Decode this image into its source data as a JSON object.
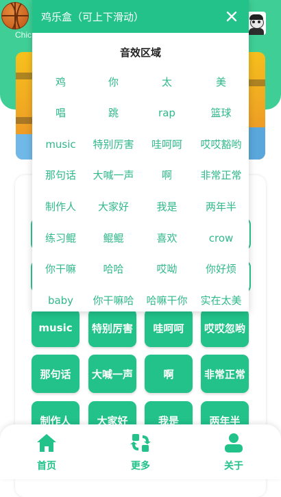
{
  "app": {
    "chip_label": "Chic"
  },
  "modal": {
    "title": "鸡乐盒（可上下滑动）",
    "close_icon": "close-icon",
    "section_title": "音效区域",
    "sounds": [
      "鸡",
      "你",
      "太",
      "美",
      "唱",
      "跳",
      "rap",
      "篮球",
      "music",
      "特别厉害",
      "哇呵呵",
      "哎哎豁哟",
      "那句话",
      "大喊一声",
      "啊",
      "非常正常",
      "制作人",
      "大家好",
      "我是",
      "两年半",
      "练习鲲",
      "鲲鲲",
      "喜欢",
      "crow",
      "你干嘛",
      "哈哈",
      "哎呦",
      "你好烦",
      "baby",
      "你干嘛哈",
      "哈嘛干你",
      "实在太美"
    ]
  },
  "grid": {
    "buttons": [
      "music",
      "特别厉害",
      "哇呵呵",
      "哎哎忽哟",
      "那句话",
      "大喊一声",
      "啊",
      "非常正常",
      "制作人",
      "大家好",
      "我是",
      "两年半"
    ]
  },
  "nav": {
    "items": [
      {
        "label": "首页",
        "icon": "home-icon"
      },
      {
        "label": "更多",
        "icon": "swap-icon"
      },
      {
        "label": "关于",
        "icon": "person-icon"
      }
    ]
  },
  "colors": {
    "accent": "#22c28a",
    "header_bg": "#3fcf96",
    "sound_text": "#2fb88a",
    "banner": "#f0a623"
  }
}
